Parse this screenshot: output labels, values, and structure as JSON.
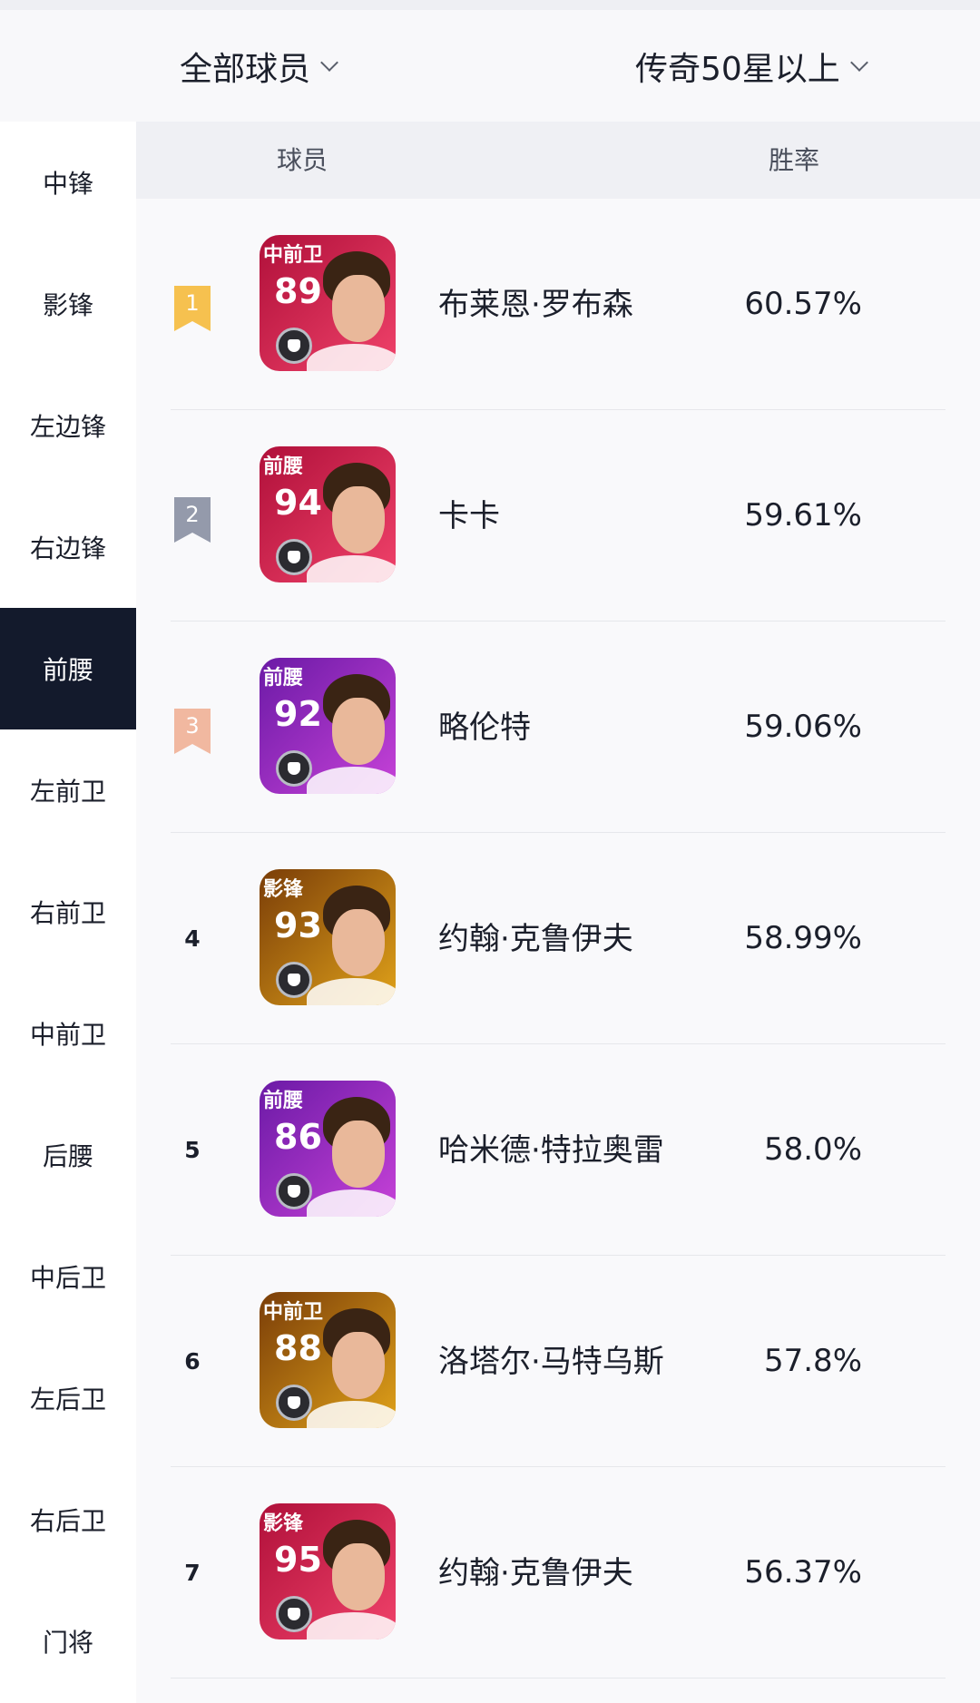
{
  "filters": {
    "players_label": "全部球员",
    "level_label": "传奇50星以上"
  },
  "sidebar": {
    "items": [
      {
        "label": "中锋"
      },
      {
        "label": "影锋"
      },
      {
        "label": "左边锋"
      },
      {
        "label": "右边锋"
      },
      {
        "label": "前腰",
        "active": true
      },
      {
        "label": "左前卫"
      },
      {
        "label": "右前卫"
      },
      {
        "label": "中前卫"
      },
      {
        "label": "后腰"
      },
      {
        "label": "中后卫"
      },
      {
        "label": "左后卫"
      },
      {
        "label": "右后卫"
      },
      {
        "label": "门将"
      }
    ]
  },
  "table": {
    "header_player": "球员",
    "header_rate": "胜率",
    "rows": [
      {
        "rank": "1",
        "position": "中前卫",
        "rating": "89",
        "name": "布莱恩·罗布森",
        "win_rate": "60.57%",
        "card_colors": [
          "#b0103a",
          "#f0426a"
        ],
        "rank_color": "#f6c14f"
      },
      {
        "rank": "2",
        "position": "前腰",
        "rating": "94",
        "name": "卡卡",
        "win_rate": "59.61%",
        "card_colors": [
          "#b0103a",
          "#f0426a"
        ],
        "rank_color": "#949aab"
      },
      {
        "rank": "3",
        "position": "前腰",
        "rating": "92",
        "name": "略伦特",
        "win_rate": "59.06%",
        "card_colors": [
          "#6b1aa6",
          "#c742d8"
        ],
        "rank_color": "#f1b8a0"
      },
      {
        "rank": "4",
        "position": "影锋",
        "rating": "93",
        "name": "约翰·克鲁伊夫",
        "win_rate": "58.99%",
        "card_colors": [
          "#7a3d08",
          "#e0a21a"
        ]
      },
      {
        "rank": "5",
        "position": "前腰",
        "rating": "86",
        "name": "哈米德·特拉奥雷",
        "win_rate": "58.0%",
        "card_colors": [
          "#6b1aa6",
          "#c742d8"
        ]
      },
      {
        "rank": "6",
        "position": "中前卫",
        "rating": "88",
        "name": "洛塔尔·马特乌斯",
        "win_rate": "57.8%",
        "card_colors": [
          "#7a3d08",
          "#e0a21a"
        ]
      },
      {
        "rank": "7",
        "position": "影锋",
        "rating": "95",
        "name": "约翰·克鲁伊夫",
        "win_rate": "56.37%",
        "card_colors": [
          "#b0103a",
          "#f0426a"
        ]
      }
    ]
  }
}
